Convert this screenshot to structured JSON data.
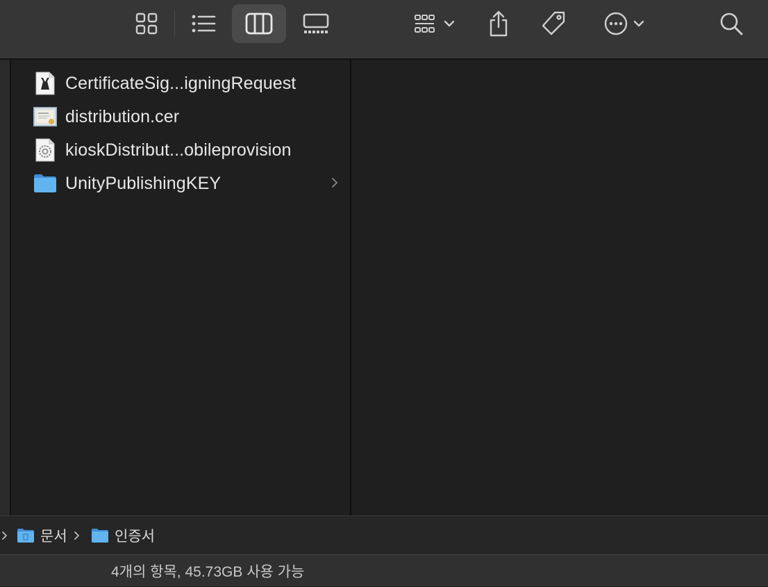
{
  "toolbar": {
    "view_modes": [
      {
        "name": "icon-view",
        "selected": false
      },
      {
        "name": "list-view",
        "selected": false
      },
      {
        "name": "column-view",
        "selected": true
      },
      {
        "name": "gallery-view",
        "selected": false
      }
    ],
    "icons": [
      "group-icon",
      "share-icon",
      "tag-icon",
      "more-icon",
      "search-icon"
    ]
  },
  "files": [
    {
      "name": "CertificateSig...igningRequest",
      "icon": "certificate-request-icon"
    },
    {
      "name": "distribution.cer",
      "icon": "certificate-icon"
    },
    {
      "name": "kioskDistribut...obileprovision",
      "icon": "provisioning-profile-icon"
    },
    {
      "name": "UnityPublishingKEY",
      "icon": "folder-icon",
      "is_folder": true
    }
  ],
  "path": [
    "문서",
    "인증서"
  ],
  "status": "4개의 항목, 45.73GB 사용 가능",
  "colors": {
    "folder": "#5aaee8",
    "background": "#1f1f1f",
    "toolbar": "#363636"
  }
}
